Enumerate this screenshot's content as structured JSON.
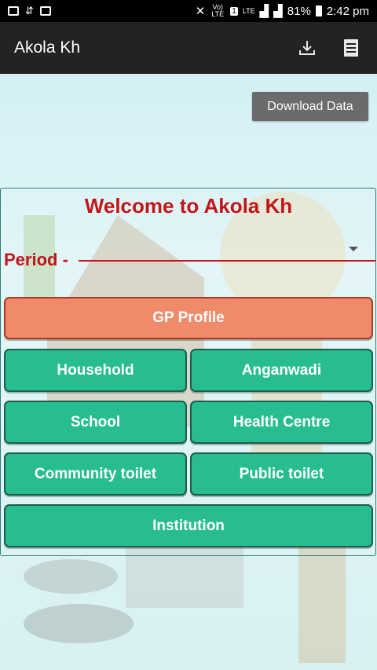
{
  "status_bar": {
    "network_label": "Vo) LTE",
    "sim_badge": "1",
    "lte_label": "LTE",
    "battery": "81%",
    "time": "2:42 pm"
  },
  "app_bar": {
    "title": "Akola Kh",
    "icons": [
      "download-icon",
      "list-icon"
    ]
  },
  "download_button": "Download Data",
  "welcome": "Welcome to Akola Kh",
  "period": {
    "label": "Period -",
    "selected_value": ""
  },
  "menu": {
    "gp_profile": "GP Profile",
    "household": "Household",
    "anganwadi": "Anganwadi",
    "school": "School",
    "health_centre": "Health Centre",
    "community_toilet": "Community toilet",
    "public_toilet": "Public toilet",
    "institution": "Institution"
  },
  "colors": {
    "appbar": "#232323",
    "accent_red": "#c0161a",
    "button_green": "#28bd91",
    "button_orange": "#ef8a6a"
  }
}
